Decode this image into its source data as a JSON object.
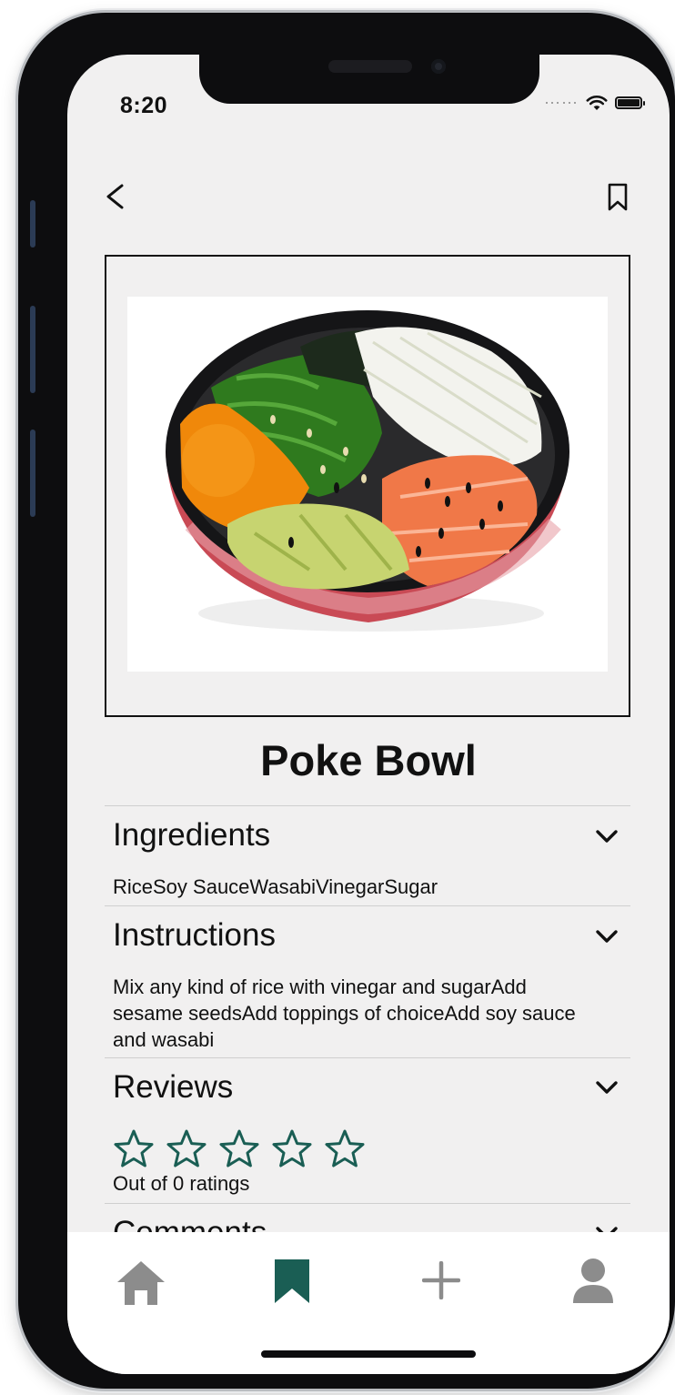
{
  "status_bar": {
    "time": "8:20"
  },
  "recipe": {
    "title": "Poke Bowl",
    "image_alt": "poke-bowl-photo"
  },
  "sections": {
    "ingredients": {
      "heading": "Ingredients",
      "text": "RiceSoy SauceWasabiVinegarSugar"
    },
    "instructions": {
      "heading": "Instructions",
      "text": "Mix any kind of rice with vinegar and sugarAdd sesame seedsAdd toppings of choiceAdd soy sauce and wasabi"
    },
    "reviews": {
      "heading": "Reviews",
      "rating": 0,
      "max_rating": 5,
      "ratings_text": "Out of 0 ratings"
    },
    "comments": {
      "heading": "Comments"
    }
  },
  "nav": {
    "items": [
      {
        "icon": "home-icon",
        "active": false
      },
      {
        "icon": "bookmark-icon",
        "active": true
      },
      {
        "icon": "plus-icon",
        "active": false
      },
      {
        "icon": "profile-icon",
        "active": false
      }
    ]
  },
  "colors": {
    "accent": "#1a5e54",
    "inactive": "#8c8c8c",
    "background": "#f1f0f0"
  }
}
